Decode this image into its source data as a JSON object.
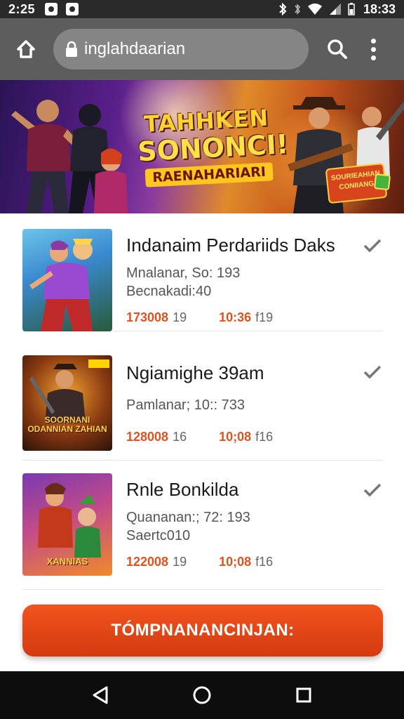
{
  "status_bar": {
    "time": "2:25",
    "clock": "18:33"
  },
  "browser": {
    "url": "inglahdaarian"
  },
  "banner": {
    "title_line1": "TAHHKEN",
    "title_line2": "SONONCI!",
    "subtitle": "RAENAHARIARI",
    "badge": "SOURIEAHIAN CONIIANG"
  },
  "items": [
    {
      "title": "Indanaim Perdariids Daks",
      "line1": "Mnalanar, So: 193",
      "line2": "Becnakadi:40",
      "price_a": "173008",
      "price_b": "19",
      "price_c": "10:36",
      "price_d": "f19"
    },
    {
      "title": "Ngiamighe 39am",
      "line1": "Pamlanar; 10:: 733",
      "line2": "",
      "price_a": "128008",
      "price_b": "16",
      "price_c": "10;08",
      "price_d": "f16",
      "thumb_text": "SOORNANI ODANNIAN ZAHIAN"
    },
    {
      "title": "Rnle Bonkilda",
      "line1": "Quananan:; 72: 193",
      "line2": "Saertc010",
      "price_a": "122008",
      "price_b": "19",
      "price_c": "10;08",
      "price_d": "f16",
      "thumb_text": "XANNIAS"
    }
  ],
  "cta": {
    "label": "TÓMPNANANCINJAN:"
  },
  "colors": {
    "accent": "#e0531c",
    "toolbar": "#5d5d5d",
    "status": "#2a2a2a"
  }
}
